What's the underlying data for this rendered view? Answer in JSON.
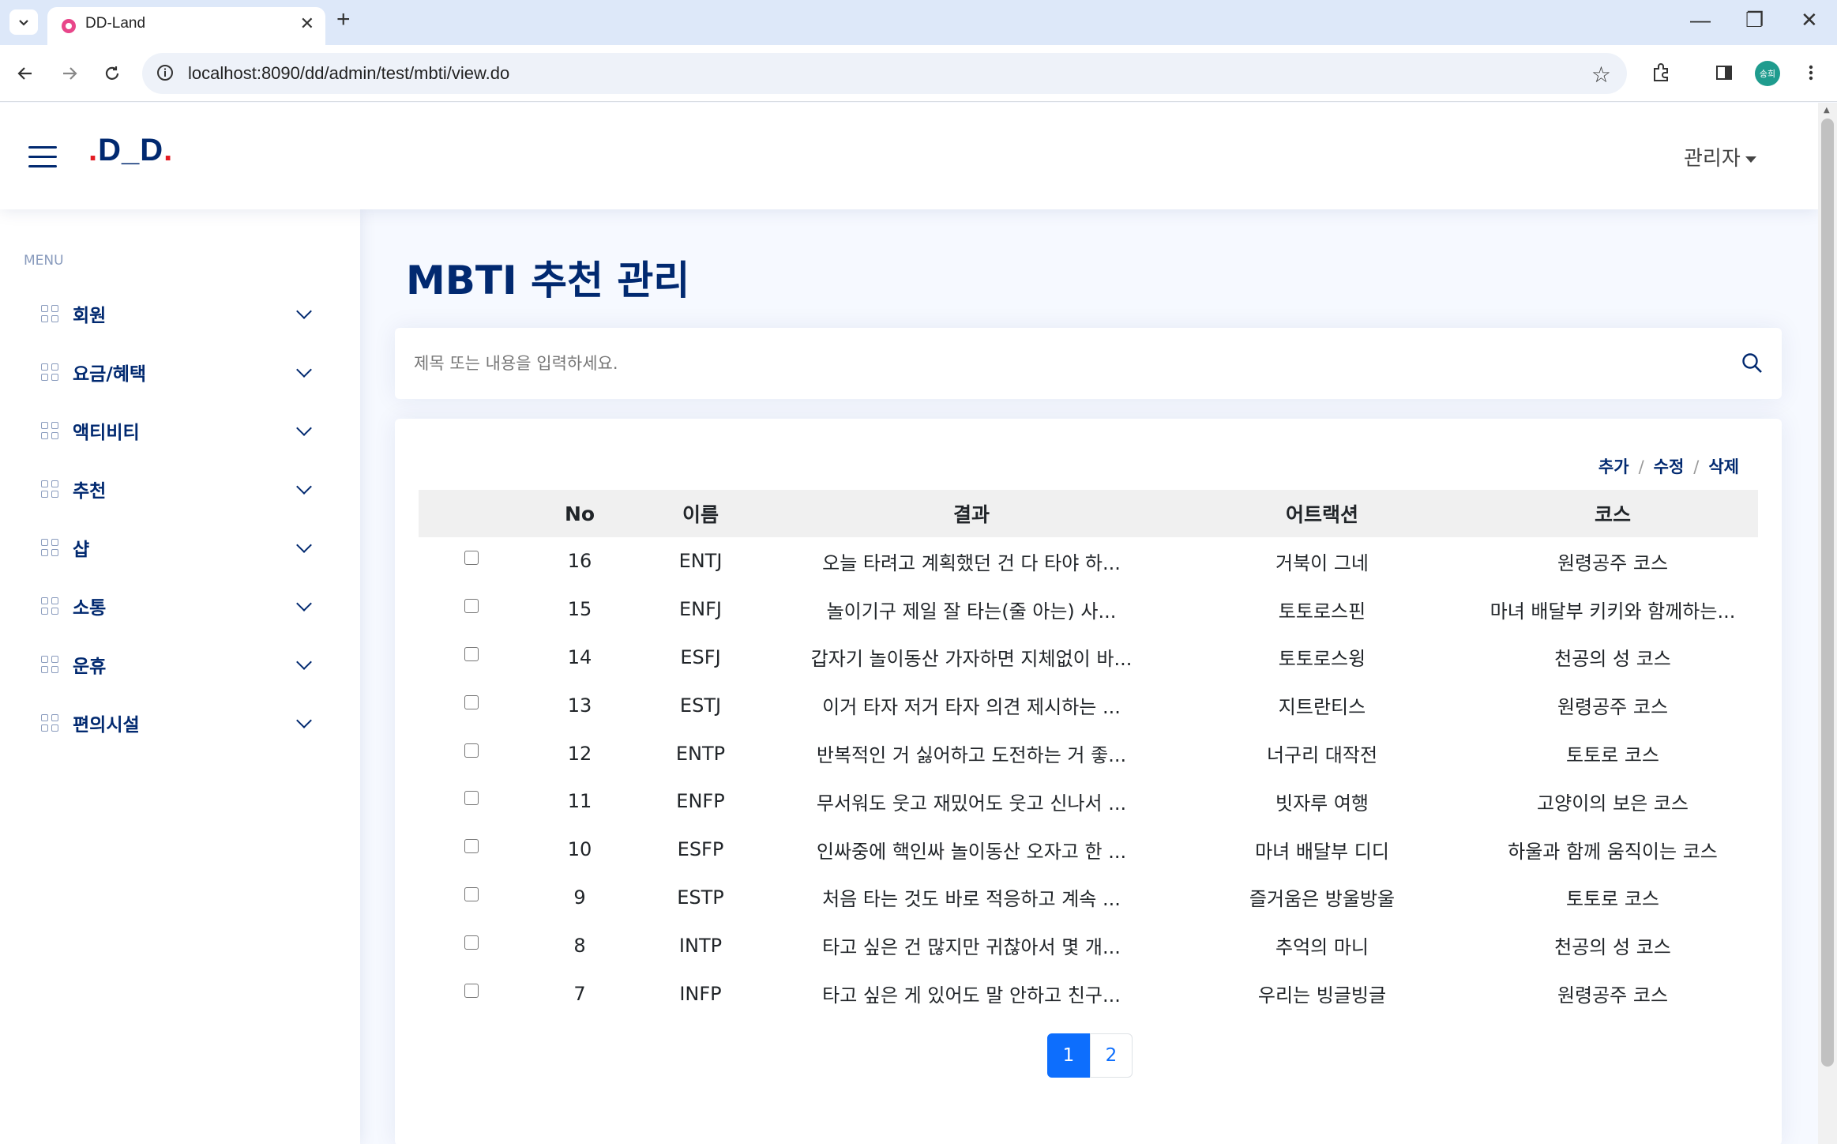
{
  "browser": {
    "tab_title": "DD-Land",
    "url": "localhost:8090/dd/admin/test/mbti/view.do",
    "avatar_text": "송희"
  },
  "header": {
    "logo_prefix": ".",
    "logo_text": "D_D",
    "logo_suffix": ".",
    "user_label": "관리자"
  },
  "sidebar": {
    "heading": "MENU",
    "items": [
      {
        "label": "회원"
      },
      {
        "label": "요금/혜택"
      },
      {
        "label": "액티비티"
      },
      {
        "label": "추천"
      },
      {
        "label": "샵"
      },
      {
        "label": "소통"
      },
      {
        "label": "운휴"
      },
      {
        "label": "편의시설"
      }
    ]
  },
  "main": {
    "title": "MBTI 추천 관리",
    "search_placeholder": "제목 또는 내용을 입력하세요.",
    "actions": {
      "add": "추가",
      "sep": "/",
      "edit": "수정",
      "delete": "삭제"
    },
    "table": {
      "columns": [
        "",
        "No",
        "이름",
        "결과",
        "어트랙션",
        "코스"
      ],
      "rows": [
        {
          "no": "16",
          "name": "ENTJ",
          "result": "오늘 타려고 계획했던 건 다 타야 하...",
          "attraction": "거북이 그네",
          "course": "원령공주 코스"
        },
        {
          "no": "15",
          "name": "ENFJ",
          "result": "놀이기구 제일 잘 타는(줄 아는) 사...",
          "attraction": "토토로스핀",
          "course": "마녀 배달부 키키와 함께하는..."
        },
        {
          "no": "14",
          "name": "ESFJ",
          "result": "갑자기 놀이동산 가자하면 지체없이 바...",
          "attraction": "토토로스윙",
          "course": "천공의 성 코스"
        },
        {
          "no": "13",
          "name": "ESTJ",
          "result": "이거 타자 저거 타자 의견 제시하는 ...",
          "attraction": "지트란티스",
          "course": "원령공주 코스"
        },
        {
          "no": "12",
          "name": "ENTP",
          "result": "반복적인 거 싫어하고 도전하는 거 좋...",
          "attraction": "너구리 대작전",
          "course": "토토로 코스"
        },
        {
          "no": "11",
          "name": "ENFP",
          "result": "무서워도 웃고 재밌어도 웃고 신나서 ...",
          "attraction": "빗자루 여행",
          "course": "고양이의 보은 코스"
        },
        {
          "no": "10",
          "name": "ESFP",
          "result": "인싸중에 핵인싸 놀이동산 오자고 한 ...",
          "attraction": "마녀 배달부 디디",
          "course": "하울과 함께 움직이는 코스"
        },
        {
          "no": "9",
          "name": "ESTP",
          "result": "처음 타는 것도 바로 적응하고 계속 ...",
          "attraction": "즐거움은 방울방울",
          "course": "토토로 코스"
        },
        {
          "no": "8",
          "name": "INTP",
          "result": "타고 싶은 건 많지만 귀찮아서 몇 개...",
          "attraction": "추억의 마니",
          "course": "천공의 성 코스"
        },
        {
          "no": "7",
          "name": "INFP",
          "result": "타고 싶은 게 있어도 말 안하고 친구...",
          "attraction": "우리는 빙글빙글",
          "course": "원령공주 코스"
        }
      ]
    },
    "pagination": [
      "1",
      "2"
    ]
  }
}
